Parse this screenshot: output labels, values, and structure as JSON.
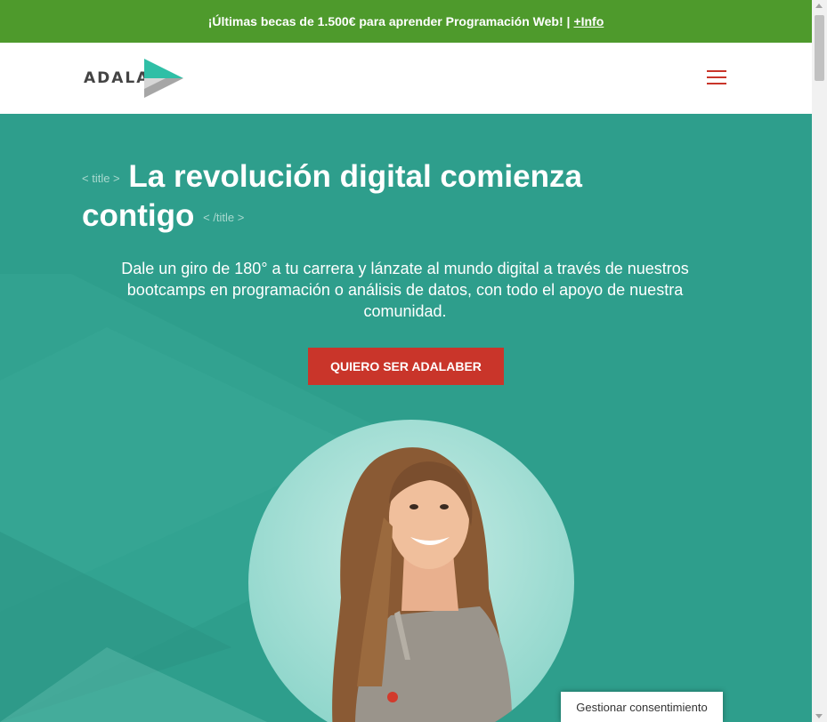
{
  "promo": {
    "text": "¡Últimas becas de 1.500€ para aprender Programación Web! |",
    "link": "+Info"
  },
  "header": {
    "logo_text": "ADALAB",
    "menu_icon": "hamburger-menu-icon"
  },
  "hero": {
    "tag_open": "< title >",
    "title": "La revolución digital comienza contigo",
    "tag_close": "< /title >",
    "subtitle": "Dale un giro de 180° a tu carrera y lánzate al mundo digital a través de nuestros bootcamps en programación o análisis de datos, con todo el apoyo de nuestra comunidad.",
    "cta": "QUIERO SER ADALABER"
  },
  "consent": {
    "label": "Gestionar consentimiento"
  },
  "colors": {
    "promo_bg": "#4e9a2c",
    "hero_bg": "#2e9e8c",
    "accent": "#c9352a"
  }
}
